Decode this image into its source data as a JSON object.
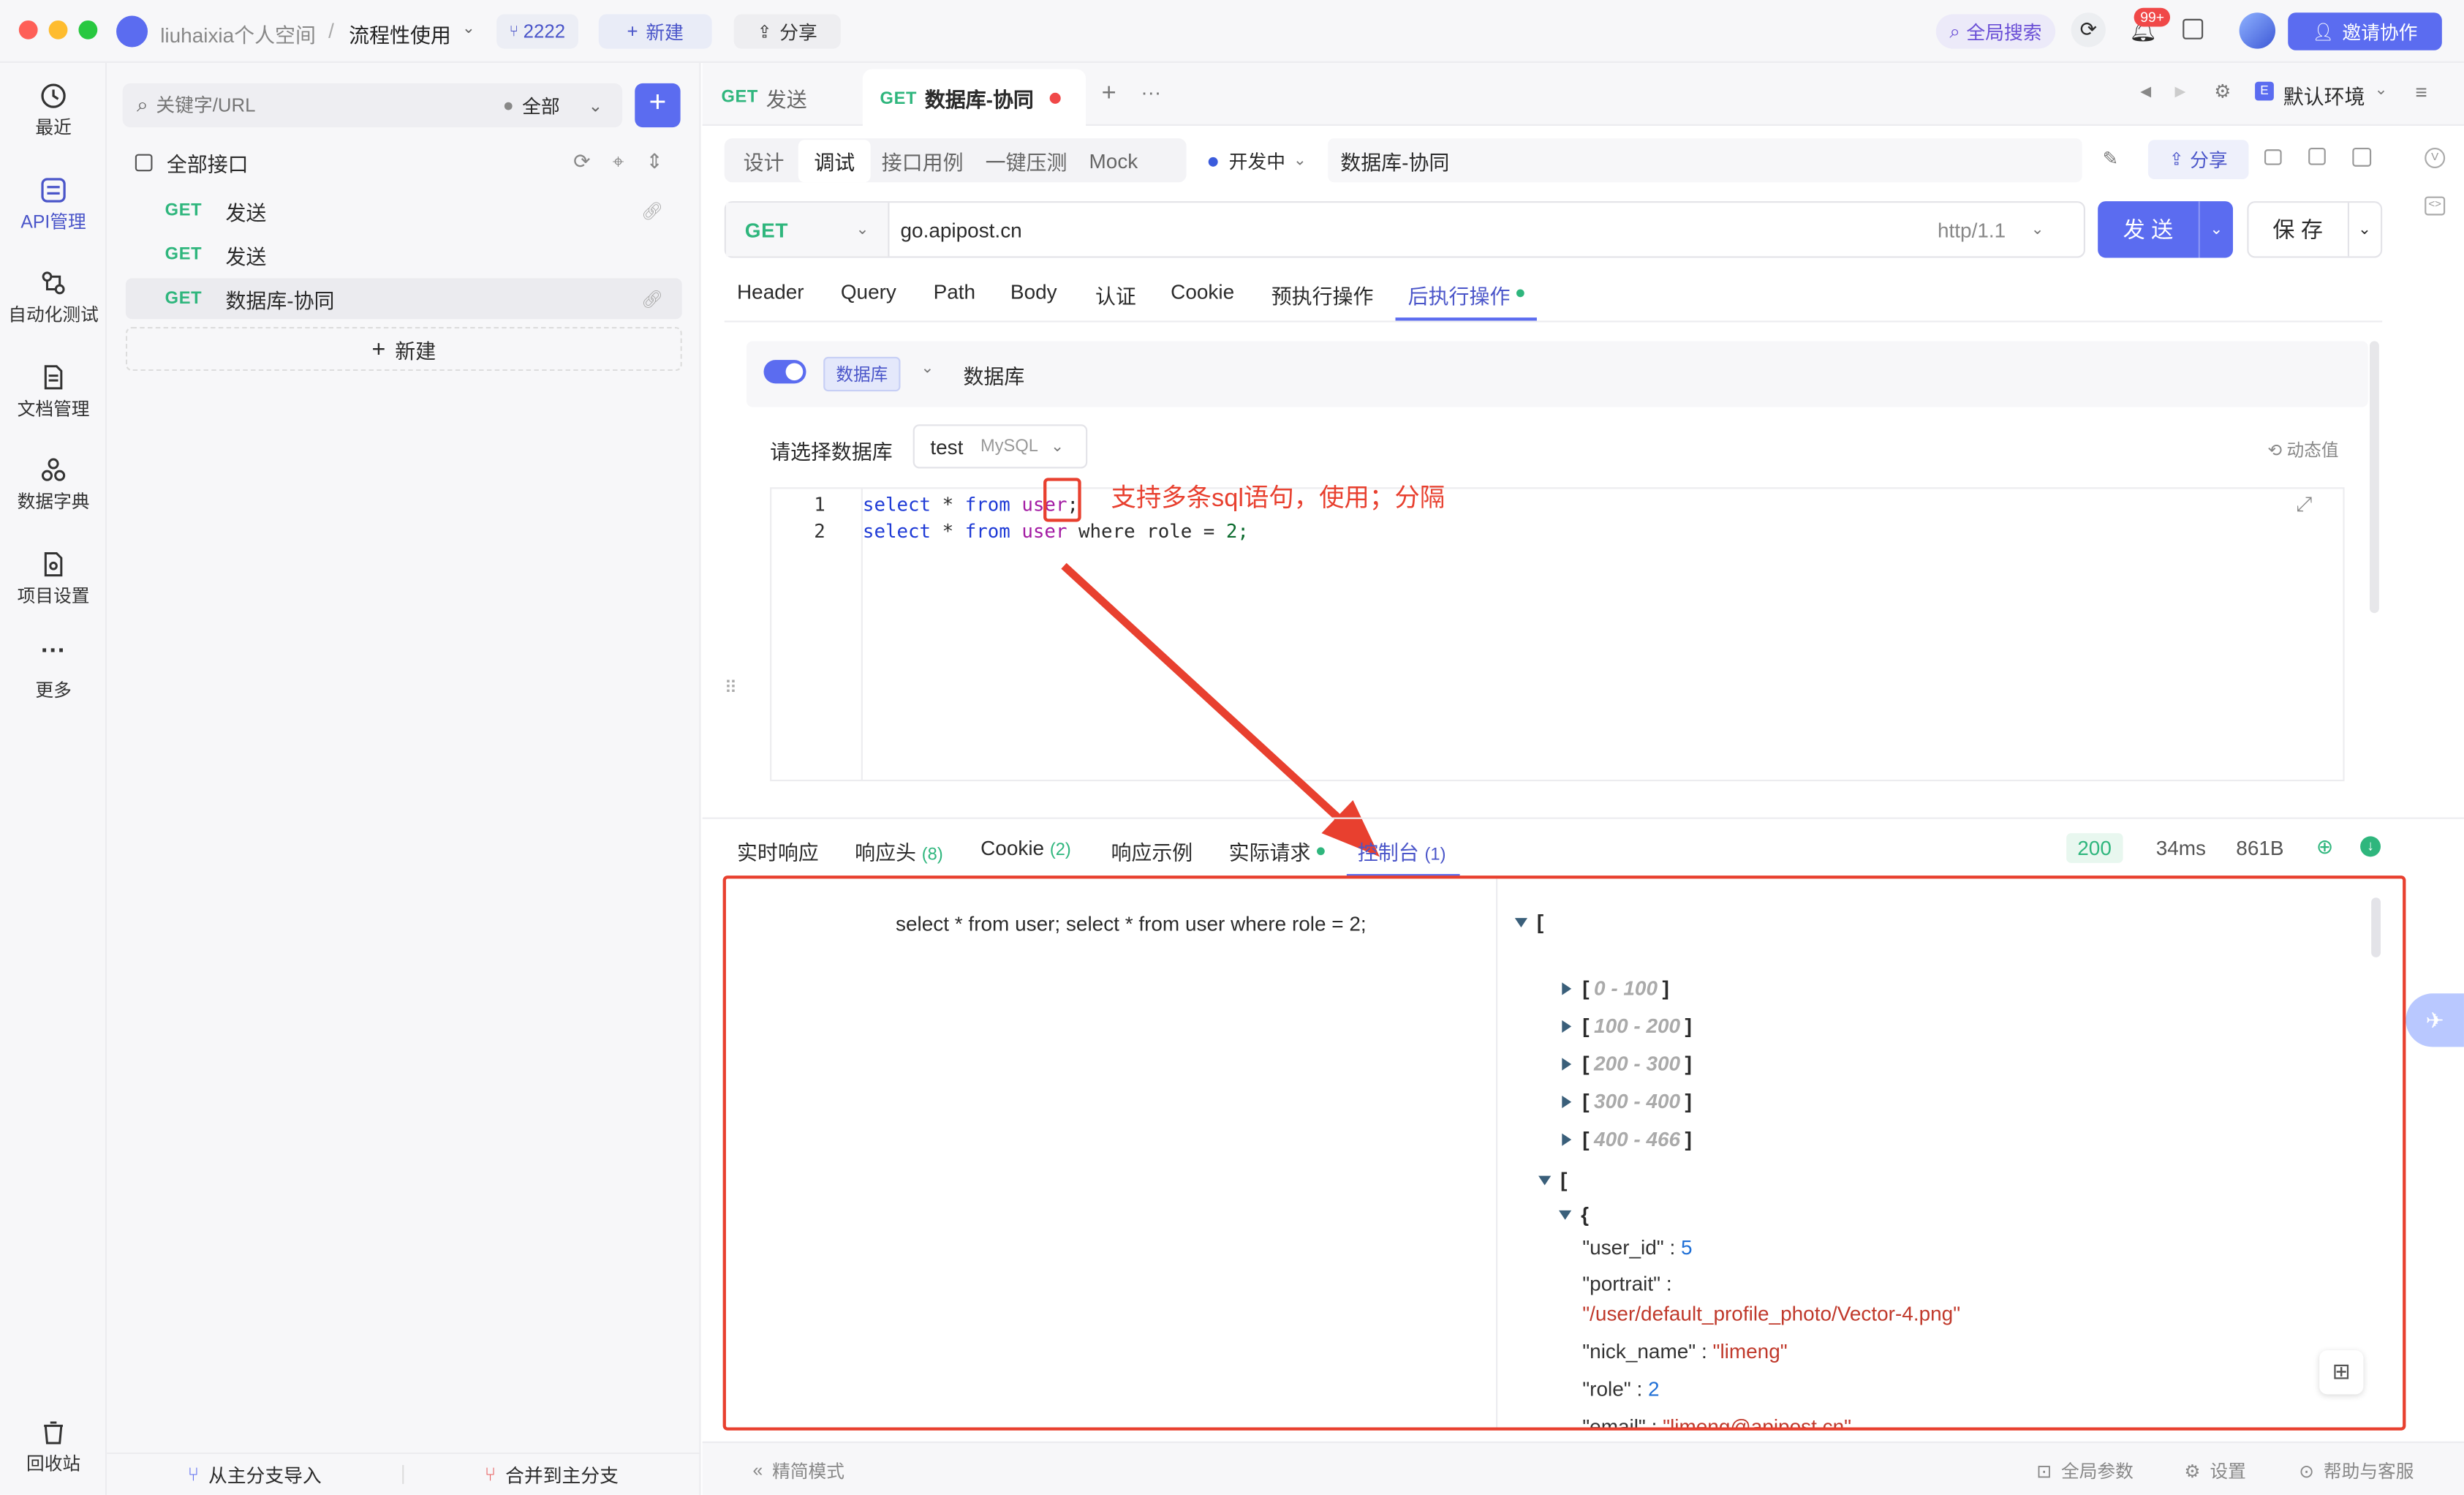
{
  "titlebar": {
    "workspace": "liuhaixia个人空间",
    "separator": "/",
    "project": "流程性使用",
    "member_count": "2222",
    "new_label": "新建",
    "share_label": "分享",
    "global_search": "全局搜索",
    "notif_badge": "99+",
    "invite_label": "邀请协作"
  },
  "leftnav": {
    "items": [
      {
        "label": "最近"
      },
      {
        "label": "API管理"
      },
      {
        "label": "自动化测试"
      },
      {
        "label": "文档管理"
      },
      {
        "label": "数据字典"
      },
      {
        "label": "项目设置"
      },
      {
        "label": "更多"
      }
    ],
    "trash": "回收站"
  },
  "sidebar": {
    "search_placeholder": "关键字/URL",
    "filter": "全部",
    "root": "全部接口",
    "items": [
      {
        "method": "GET",
        "name": "发送"
      },
      {
        "method": "GET",
        "name": "发送"
      },
      {
        "method": "GET",
        "name": "数据库-协同"
      }
    ],
    "new_label": "新建",
    "import_label": "从主分支导入",
    "merge_label": "合并到主分支"
  },
  "tabs": [
    {
      "method": "GET",
      "name": "发送"
    },
    {
      "method": "GET",
      "name": "数据库-协同"
    }
  ],
  "env": "默认环境",
  "modes": [
    "设计",
    "调试",
    "接口用例",
    "一键压测",
    "Mock"
  ],
  "status": "开发中",
  "api_name": "数据库-协同",
  "share_btn": "分享",
  "request": {
    "method": "GET",
    "url": "go.apipost.cn",
    "protocol": "http/1.1",
    "send": "发 送",
    "save": "保 存"
  },
  "req_tabs": [
    "Header",
    "Query",
    "Path",
    "Body",
    "认证",
    "Cookie",
    "预执行操作",
    "后执行操作"
  ],
  "db_panel": {
    "tag": "数据库",
    "title": "数据库",
    "select_label": "请选择数据库",
    "db_name": "test",
    "db_type": "MySQL",
    "dynamic": "动态值",
    "sql_lines": [
      {
        "no": "1",
        "kw1": "select",
        "op": " * ",
        "kw2": "from",
        "tbl": " user",
        "rest": ";",
        "num": ""
      },
      {
        "no": "2",
        "kw1": "select",
        "op": " * ",
        "kw2": "from",
        "tbl": " user",
        "rest": " where role = ",
        "num": "2;"
      }
    ],
    "annotation": "支持多条sql语句，使用；分隔"
  },
  "resp_tabs": [
    {
      "label": "实时响应",
      "count": ""
    },
    {
      "label": "响应头",
      "count": "(8)"
    },
    {
      "label": "Cookie",
      "count": "(2)"
    },
    {
      "label": "响应示例",
      "count": ""
    },
    {
      "label": "实际请求",
      "count": ""
    },
    {
      "label": "控制台",
      "count": "(1)"
    }
  ],
  "resp_meta": {
    "code": "200",
    "time": "34ms",
    "size": "861B"
  },
  "console": {
    "sql": "select * from user; select * from user where role = 2;",
    "open_bracket": "[",
    "ranges": [
      "0 - 100",
      "100 - 200",
      "200 - 300",
      "300 - 400",
      "400 - 466"
    ],
    "inner_bracket": "[",
    "obj_brace": "{",
    "fields": [
      {
        "key": "\"user_id\"",
        "value": "5",
        "type": "num"
      },
      {
        "key": "\"portrait\"",
        "value": "\"/user/default_profile_photo/Vector-4.png\"",
        "type": "str"
      },
      {
        "key": "\"nick_name\"",
        "value": "\"limeng\"",
        "type": "str"
      },
      {
        "key": "\"role\"",
        "value": "2",
        "type": "num"
      },
      {
        "key": "\"email\"",
        "value": "\"limeng@apipost.cn\"",
        "type": "str"
      }
    ]
  },
  "footer": {
    "simple_mode": "精简模式",
    "global_params": "全局参数",
    "settings": "设置",
    "help": "帮助与客服"
  },
  "colors": {
    "accent": "#5b6cf0",
    "get": "#2fb67d",
    "annotation": "#e8402f"
  }
}
